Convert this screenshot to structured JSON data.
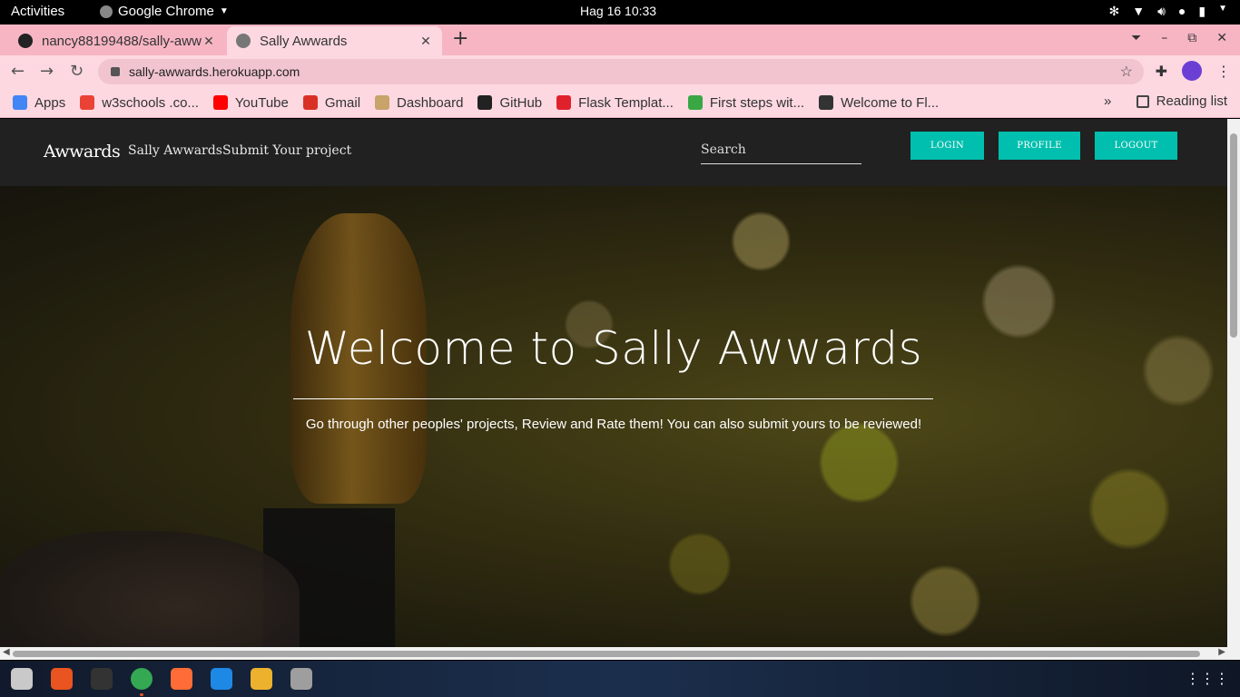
{
  "system": {
    "activities": "Activities",
    "app_name": "Google Chrome",
    "clock": "Hag 16  10:33"
  },
  "browser": {
    "tabs": [
      {
        "title": "nancy88199488/sally-aww",
        "icon": "github-icon"
      },
      {
        "title": "Sally Awwards",
        "icon": "globe-icon"
      }
    ],
    "url": "sally-awwards.herokuapp.com",
    "bookmarks": [
      {
        "label": "Apps",
        "icon": "apps-grid-icon",
        "color": "#4285f4"
      },
      {
        "label": "w3schools .co...",
        "icon": "google-icon",
        "color": "#ea4335"
      },
      {
        "label": "YouTube",
        "icon": "youtube-icon",
        "color": "#ff0000"
      },
      {
        "label": "Gmail",
        "icon": "gmail-icon",
        "color": "#d93025"
      },
      {
        "label": "Dashboard",
        "icon": "dashboard-icon",
        "color": "#c8a36a"
      },
      {
        "label": "GitHub",
        "icon": "github-icon",
        "color": "#222222"
      },
      {
        "label": "Flask Templat...",
        "icon": "flask-icon",
        "color": "#e0212c"
      },
      {
        "label": "First steps wit...",
        "icon": "first-steps-icon",
        "color": "#3aa745"
      },
      {
        "label": "Welcome to Fl...",
        "icon": "welcome-icon",
        "color": "#333333"
      }
    ],
    "more_bookmarks": "»",
    "reading_list": "Reading list"
  },
  "site": {
    "brand": "Awwards",
    "nav_links": [
      "Sally Awwards",
      "Submit Your project"
    ],
    "search_placeholder": "Search",
    "buttons": {
      "login": "LOGIN",
      "profile": "PROFILE",
      "logout": "LOGOUT"
    },
    "accent_color": "#00bfae",
    "hero": {
      "title": "Welcome to Sally Awwards",
      "subtitle": "Go through other peoples' projects, Review and Rate them! You can also submit yours to be reviewed!"
    }
  },
  "dock": {
    "apps": [
      {
        "name": "files-icon",
        "color": "#c9c9c9"
      },
      {
        "name": "software-center-icon",
        "color": "#e95420"
      },
      {
        "name": "terminal-icon",
        "color": "#333333"
      },
      {
        "name": "chrome-icon",
        "color": "#34a853"
      },
      {
        "name": "postman-icon",
        "color": "#ff6c37"
      },
      {
        "name": "vscode-icon",
        "color": "#1e88e5"
      },
      {
        "name": "slack-icon",
        "color": "#ecb22e"
      },
      {
        "name": "settings-icon",
        "color": "#9e9e9e"
      }
    ]
  }
}
